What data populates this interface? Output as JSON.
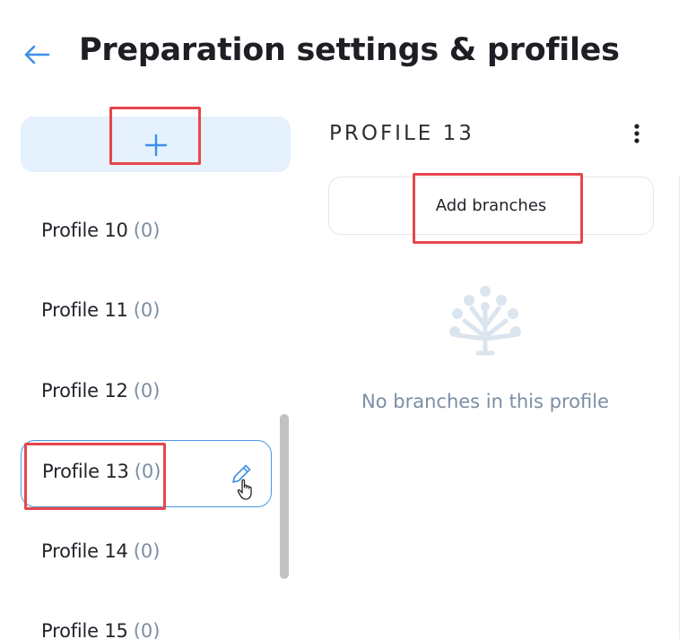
{
  "header": {
    "back_icon": "arrow-left-icon",
    "title": "Preparation settings & profiles"
  },
  "sidebar": {
    "add_button_icon": "plus-icon",
    "profiles": [
      {
        "name": "Profile 10",
        "count": "(0)",
        "active": false
      },
      {
        "name": "Profile 11",
        "count": "(0)",
        "active": false
      },
      {
        "name": "Profile 12",
        "count": "(0)",
        "active": false
      },
      {
        "name": "Profile 13",
        "count": "(0)",
        "active": true
      },
      {
        "name": "Profile 14",
        "count": "(0)",
        "active": false
      },
      {
        "name": "Profile 15",
        "count": "(0)",
        "active": false
      }
    ],
    "edit_icon": "pencil-icon",
    "cursor_icon": "hand-pointer-icon"
  },
  "detail": {
    "heading": "PROFILE 13",
    "menu_icon": "more-vertical-icon",
    "add_branches_label": "Add branches",
    "empty_icon": "tree-icon",
    "empty_message": "No branches in this profile"
  },
  "colors": {
    "accent": "#4a96e6",
    "accent_light": "#e5f1fc",
    "muted_text": "#7c8ea3",
    "highlight": "#e5474b"
  }
}
